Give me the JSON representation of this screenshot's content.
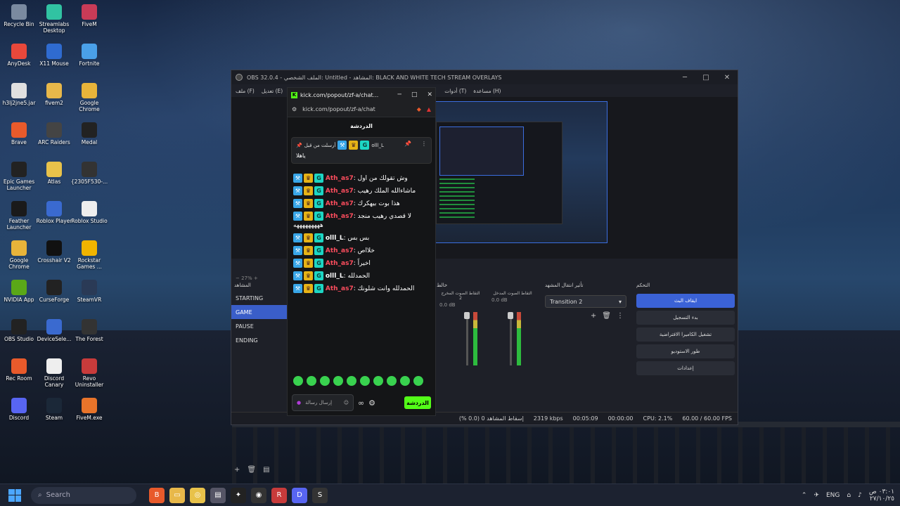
{
  "desktop": {
    "icons": [
      {
        "label": "Recycle Bin",
        "icon": "recycle-bin-icon",
        "color": "#7a8aa0"
      },
      {
        "label": "Streamlabs Desktop",
        "icon": "streamlabs-icon",
        "color": "#31c3a2"
      },
      {
        "label": "FiveM",
        "icon": "fivem-icon",
        "color": "#c83b57"
      },
      {
        "label": "AnyDesk",
        "icon": "anydesk-icon",
        "color": "#e8483b"
      },
      {
        "label": "X11 Mouse",
        "icon": "mouse-icon",
        "color": "#2f6bd0"
      },
      {
        "label": "Fortnite",
        "icon": "fortnite-icon",
        "color": "#4aa0e8"
      },
      {
        "label": "h3lj2jne5.jar",
        "icon": "java-icon",
        "color": "#e0e0e0"
      },
      {
        "label": "fivem2",
        "icon": "folder-icon",
        "color": "#e8b84a"
      },
      {
        "label": "Google Chrome",
        "icon": "chrome-icon",
        "color": "#e8b43a"
      },
      {
        "label": "Brave",
        "icon": "brave-icon",
        "color": "#e85a2b"
      },
      {
        "label": "ARC Raiders",
        "icon": "arc-raiders-icon",
        "color": "#444"
      },
      {
        "label": "Medal",
        "icon": "medal-icon",
        "color": "#222"
      },
      {
        "label": "Epic Games Launcher",
        "icon": "epic-icon",
        "color": "#222"
      },
      {
        "label": "Atlas",
        "icon": "atlas-icon",
        "color": "#e8c24a"
      },
      {
        "label": "{2305F530-...",
        "icon": "file-icon",
        "color": "#333"
      },
      {
        "label": "Feather Launcher",
        "icon": "feather-icon",
        "color": "#1a1a1a"
      },
      {
        "label": "Roblox Player",
        "icon": "roblox-icon",
        "color": "#3a6ad0"
      },
      {
        "label": "Roblox Studio",
        "icon": "roblox-studio-icon",
        "color": "#eee"
      },
      {
        "label": "Google Chrome",
        "icon": "chrome-icon",
        "color": "#e8b43a"
      },
      {
        "label": "Crosshair V2",
        "icon": "crosshair-icon",
        "color": "#111"
      },
      {
        "label": "Rockstar Games ...",
        "icon": "rockstar-icon",
        "color": "#f0b400"
      },
      {
        "label": "NVIDIA App",
        "icon": "nvidia-icon",
        "color": "#5aa818"
      },
      {
        "label": "CurseForge",
        "icon": "curseforge-icon",
        "color": "#222"
      },
      {
        "label": "SteamVR",
        "icon": "steamvr-icon",
        "color": "#2a3a56"
      },
      {
        "label": "OBS Studio",
        "icon": "obs-icon",
        "color": "#222"
      },
      {
        "label": "DeviceSele...",
        "icon": "tools-icon",
        "color": "#3a6ad0"
      },
      {
        "label": "The Forest",
        "icon": "forest-icon",
        "color": "#333"
      },
      {
        "label": "Rec Room",
        "icon": "rec-room-icon",
        "color": "#e85a2b"
      },
      {
        "label": "Discord Canary",
        "icon": "file-icon",
        "color": "#eee"
      },
      {
        "label": "Revo Uninstaller",
        "icon": "revo-icon",
        "color": "#c83b3b"
      },
      {
        "label": "Discord",
        "icon": "discord-icon",
        "color": "#5865f2"
      },
      {
        "label": "Steam",
        "icon": "steam-icon",
        "color": "#1b2838"
      },
      {
        "label": "FiveM.exe",
        "icon": "fivem-icon",
        "color": "#e8742a"
      }
    ]
  },
  "taskbar": {
    "search_placeholder": "Search",
    "tray": {
      "lang": "ENG",
      "time": "٠٣:٠١ ص",
      "date": "٢٧/١٠/٢٥"
    }
  },
  "obs": {
    "title": "OBS 32.0.4 - الملف الشخصي: Untitled - المشاهد: BLACK AND WHITE TECH STREAM OVERLAYS",
    "menu": [
      "ملف (F)",
      "تعديل (E)",
      "أدوات (T)",
      "مساعدة (H)"
    ],
    "zoom": "27%",
    "docks": {
      "scenes": "المشاهد",
      "mixer_label": "خالط",
      "transitions": "تأثير انتقال المشهد",
      "controls": "التحكم"
    },
    "scenes": [
      "STARTING",
      "GAME",
      "PAUSE",
      "ENDING"
    ],
    "mixer": {
      "ch1": {
        "label": "التقاط الصوت المخرج 2",
        "db": "0.0 dB"
      },
      "ch2": {
        "label": "التقاط الصوت المدخل",
        "db": "0.0 dB"
      }
    },
    "transition_selected": "Transition 2",
    "controls": [
      "ايقاف البث",
      "بدء التسجيل",
      "تشغيل الكاميرا الافتراضية",
      "طور الاستوديو",
      "إعدادات"
    ],
    "status": {
      "dropped": "إسقاط المشاهد 0 (0.0 %)",
      "kbps": "2319 kbps",
      "stream_time": "00:05:09",
      "rec_time": "00:00:00",
      "cpu": "CPU: 2.1%",
      "fps": "60.00 / 60.00 FPS"
    }
  },
  "chat": {
    "tab_title": "kick.com/popout/zf-a/chat...",
    "url": "kick.com/popout/zf-a/chat",
    "header": "الدردشة",
    "pinned": {
      "user": "olll_L",
      "prefix": "أرسلت من قبل",
      "message": "ياهلا"
    },
    "messages": [
      {
        "user": "Ath_as7",
        "text": "وش تقولك من اول",
        "color": "#ff4d5e"
      },
      {
        "user": "Ath_as7",
        "text": "ماشاءالله الملك رهيب",
        "color": "#ff4d5e"
      },
      {
        "user": "Ath_as7",
        "text": "هذا بوت بيهكرك",
        "color": "#ff4d5e"
      },
      {
        "user": "Ath_as7",
        "text": "لا قصدي رهيب منجد هههههههههه",
        "color": "#ff4d5e"
      },
      {
        "user": "olll_L",
        "text": "بس بس",
        "color": "#ffffff"
      },
      {
        "user": "Ath_as7",
        "text": "خلااص",
        "color": "#ff4d5e"
      },
      {
        "user": "Ath_as7",
        "text": "اخيراً",
        "color": "#ff4d5e"
      },
      {
        "user": "olll_L",
        "text": "الحمدلله",
        "color": "#ffffff"
      },
      {
        "user": "Ath_as7",
        "text": "الحمدلله وانت شلونك",
        "color": "#ff4d5e"
      }
    ],
    "input_placeholder": "إرسال رسالة",
    "send_label": "الدردشة"
  }
}
